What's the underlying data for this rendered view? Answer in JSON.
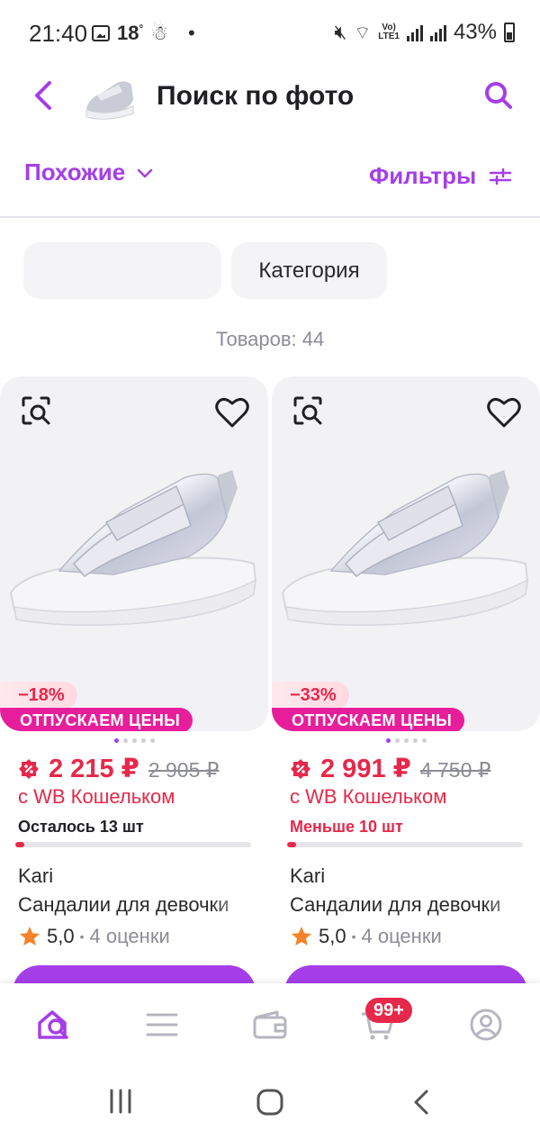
{
  "status_bar": {
    "time": "21:40",
    "temperature": "18",
    "battery": "43%",
    "network": "LTE1"
  },
  "header": {
    "title": "Поиск по фото"
  },
  "toolbar": {
    "sort_label": "Похожие",
    "filters_label": "Фильтры"
  },
  "chips": {
    "category_label": "Категория"
  },
  "results": {
    "count_text": "Товаров: 44"
  },
  "products": [
    {
      "discount": "−18%",
      "promo": "ОТПУСКАЕМ ЦЕНЫ",
      "price": "2 215 ₽",
      "old_price": "2 905 ₽",
      "wallet_text": "с WB Кошельком",
      "stock_text": "Осталось 13 шт",
      "stock_level": 0.04,
      "brand": "Kari",
      "name": "Сандалии для девочки",
      "rating": "5,0",
      "reviews": "4 оценки"
    },
    {
      "discount": "−33%",
      "promo": "ОТПУСКАЕМ ЦЕНЫ",
      "price": "2 991 ₽",
      "old_price": "4 750 ₽",
      "wallet_text": "с WB Кошельком",
      "stock_text": "Меньше 10 шт",
      "stock_level": 0.04,
      "brand": "Kari",
      "name": "Сандалии для девочки",
      "rating": "5,0",
      "reviews": "4 оценки"
    }
  ],
  "bottom_nav": {
    "cart_badge": "99+",
    "items": [
      "home-icon",
      "catalog-icon",
      "wallet-icon",
      "cart-icon",
      "profile-icon"
    ]
  },
  "colors": {
    "accent": "#a53ee8",
    "price": "#e6284a",
    "promo": "#e71e9b",
    "stock_low": "#e6284a"
  }
}
